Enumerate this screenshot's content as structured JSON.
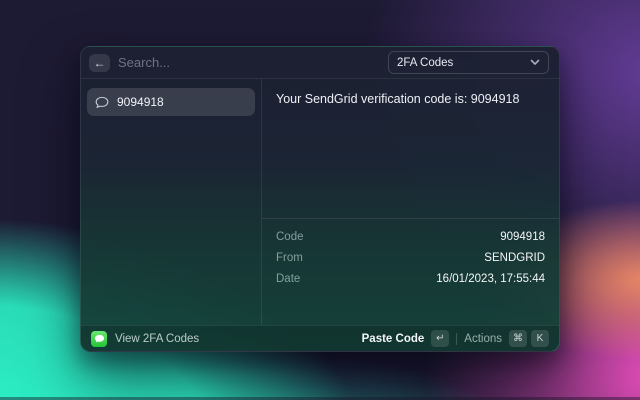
{
  "window": {
    "header": {
      "back_icon_glyph": "←",
      "search_placeholder": "Search...",
      "dropdown": {
        "value": "2FA Codes"
      }
    },
    "list": {
      "items": [
        {
          "icon": "chat-bubble",
          "label": "9094918",
          "selected": true
        }
      ]
    },
    "detail": {
      "message": "Your SendGrid verification code is: 9094918",
      "metadata": [
        {
          "label": "Code",
          "value": "9094918"
        },
        {
          "label": "From",
          "value": "SENDGRID"
        },
        {
          "label": "Date",
          "value": "16/01/2023, 17:55:44"
        }
      ]
    },
    "footer": {
      "app_icon": "messages-app",
      "app_label": "View 2FA Codes",
      "primary_action": "Paste Code",
      "primary_key": "↵",
      "secondary_action": "Actions",
      "secondary_keys": [
        "⌘",
        "K"
      ]
    }
  },
  "colors": {
    "accent_mint": "#2cf6ca",
    "accent_pink": "#ee4fc0",
    "accent_purple": "#6a3fa0",
    "accent_orange": "#fa9660",
    "window_top": "#1d2032",
    "window_bottom": "#14433a",
    "messages_icon_green": "#24c634"
  }
}
